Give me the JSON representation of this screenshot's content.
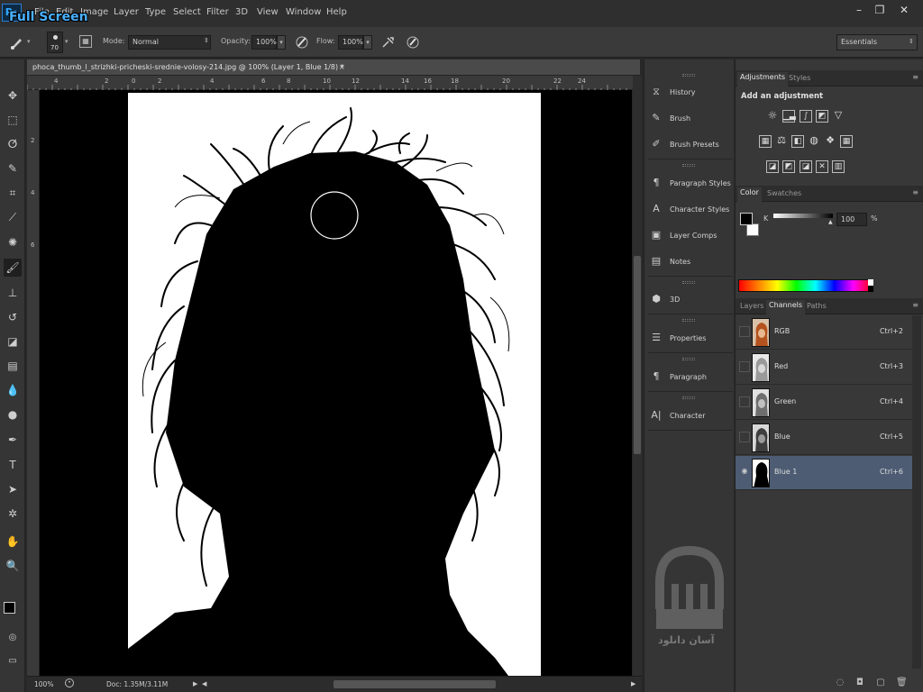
{
  "app": {
    "logo": "Ps",
    "overlay_label": "Full Screen"
  },
  "menubar": {
    "items": [
      "File",
      "Edit",
      "Image",
      "Layer",
      "Type",
      "Select",
      "Filter",
      "3D",
      "View",
      "Window",
      "Help"
    ],
    "window_controls": {
      "minimize": "–",
      "restore": "❐",
      "close": "✕"
    }
  },
  "options": {
    "brush_size": "70",
    "mode_label": "Mode:",
    "mode_value": "Normal",
    "opacity_label": "Opacity:",
    "opacity_value": "100%",
    "flow_label": "Flow:",
    "flow_value": "100%",
    "workspace": "Essentials"
  },
  "document": {
    "tab_title": "phoca_thumb_l_strizhki-pricheski-srednie-volosy-214.jpg @ 100% (Layer 1, Blue 1/8) *",
    "close": "×",
    "ruler_h": [
      "4",
      "2",
      "0",
      "2",
      "4",
      "6",
      "8",
      "10",
      "12",
      "14",
      "16",
      "18",
      "20",
      "22",
      "24"
    ],
    "ruler_v": [
      "2",
      "4",
      "6"
    ],
    "zoom": "100%",
    "doc_info": "Doc: 1.35M/3.11M"
  },
  "collapsed_panels": [
    {
      "label": "History",
      "icon": "history-icon"
    },
    {
      "label": "Brush",
      "icon": "brush-icon"
    },
    {
      "label": "Brush Presets",
      "icon": "brush-presets-icon"
    },
    {
      "label": "Paragraph Styles",
      "icon": "paragraph-styles-icon"
    },
    {
      "label": "Character Styles",
      "icon": "character-styles-icon"
    },
    {
      "label": "Layer Comps",
      "icon": "layer-comps-icon"
    },
    {
      "label": "Notes",
      "icon": "notes-icon"
    },
    {
      "label": "3D",
      "icon": "3d-icon"
    },
    {
      "label": "Properties",
      "icon": "properties-icon"
    },
    {
      "label": "Paragraph",
      "icon": "paragraph-icon"
    },
    {
      "label": "Character",
      "icon": "character-icon"
    }
  ],
  "adjustments": {
    "tabs": [
      "Adjustments",
      "Styles"
    ],
    "heading": "Add an adjustment"
  },
  "color": {
    "tabs": [
      "Color",
      "Swatches"
    ],
    "channel_label": "K",
    "value": "100",
    "unit": "%"
  },
  "channels_panel": {
    "tabs": [
      "Layers",
      "Channels",
      "Paths"
    ],
    "rows": [
      {
        "name": "RGB",
        "shortcut": "Ctrl+2"
      },
      {
        "name": "Red",
        "shortcut": "Ctrl+3"
      },
      {
        "name": "Green",
        "shortcut": "Ctrl+4"
      },
      {
        "name": "Blue",
        "shortcut": "Ctrl+5"
      },
      {
        "name": "Blue 1",
        "shortcut": "Ctrl+6"
      }
    ]
  },
  "watermark": {
    "text": "آسان دانلود"
  },
  "colors": {
    "accent": "#31a8ff",
    "selected_row": "#4d5c73"
  }
}
